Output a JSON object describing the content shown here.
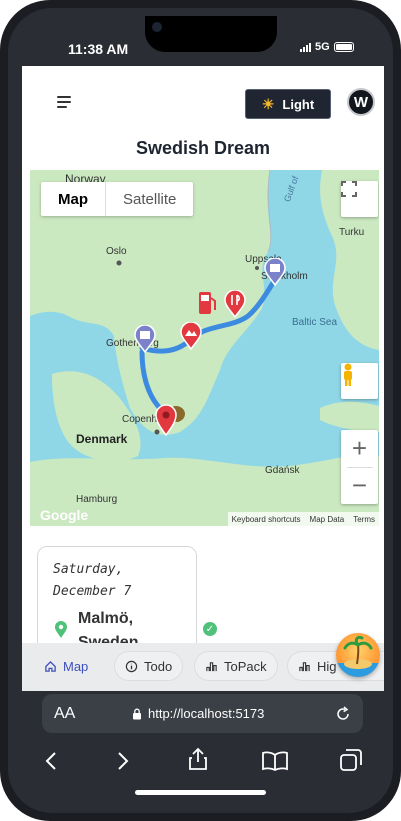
{
  "status": {
    "time": "11:38 AM",
    "network": "5G"
  },
  "header": {
    "theme_label": "Light",
    "avatar_letter": "W"
  },
  "page": {
    "title": "Swedish Dream"
  },
  "map": {
    "types": [
      {
        "label": "Map",
        "active": true
      },
      {
        "label": "Satellite",
        "active": false
      }
    ],
    "labels": {
      "norway": "Norway",
      "oslo": "Oslo",
      "uppsala": "Uppsala",
      "stockholm": "Stockholm",
      "gothenburg": "Gothenburg",
      "copenhagen": "Copenhagen",
      "denmark": "Denmark",
      "hamburg": "Hamburg",
      "gdansk": "Gdańsk",
      "turku": "Turku",
      "baltic": "Baltic Sea",
      "gulf": "Gulf of"
    },
    "attribution": {
      "shortcuts": "Keyboard shortcuts",
      "data": "Map Data",
      "terms": "Terms"
    },
    "logo": "Google",
    "controls": {
      "zoom_in": "+",
      "zoom_out": "−"
    },
    "colors": {
      "route": "#3d8be0",
      "land": "#c9e8c3",
      "water": "#8fd7e7",
      "marker": "#e2383f"
    }
  },
  "day_card": {
    "date_line1": "Saturday,",
    "date_line2": "December 7",
    "location_line1": "Malmö,",
    "location_line2": "Sweden"
  },
  "tabs": [
    {
      "label": "Map",
      "icon": "home-icon",
      "active": true
    },
    {
      "label": "Todo",
      "icon": "info-icon",
      "active": false
    },
    {
      "label": "ToPack",
      "icon": "bar-chart-icon",
      "active": false
    },
    {
      "label": "Hig",
      "icon": "bar-chart-icon",
      "active": false
    }
  ],
  "browser": {
    "aa": "AA",
    "url": "http://localhost:5173"
  }
}
